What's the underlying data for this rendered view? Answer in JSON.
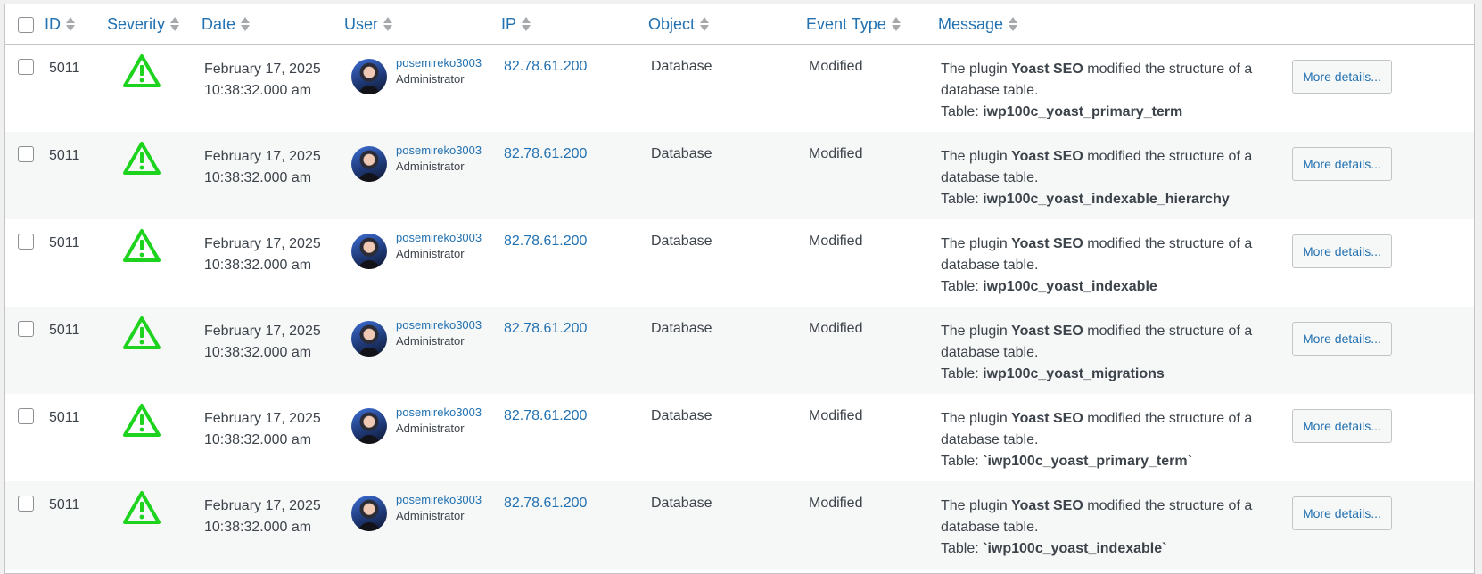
{
  "columns": {
    "id": "ID",
    "severity": "Severity",
    "date": "Date",
    "user": "User",
    "ip": "IP",
    "object": "Object",
    "event_type": "Event Type",
    "message": "Message"
  },
  "severity_icon": "warning-triangle-icon",
  "severity_color": "#1ed31e",
  "rows": [
    {
      "id": "5011",
      "date": "February 17, 2025",
      "time": "10:38:32.000 am",
      "username": "posemireko3003",
      "role": "Administrator",
      "ip": "82.78.61.200",
      "object": "Database",
      "event_type": "Modified",
      "msg_prefix": "The plugin ",
      "msg_plugin": "Yoast SEO",
      "msg_suffix": " modified the structure of a database table.",
      "msg_table_label": "Table: ",
      "msg_table": "iwp100c_yoast_primary_term",
      "more": "More details..."
    },
    {
      "id": "5011",
      "date": "February 17, 2025",
      "time": "10:38:32.000 am",
      "username": "posemireko3003",
      "role": "Administrator",
      "ip": "82.78.61.200",
      "object": "Database",
      "event_type": "Modified",
      "msg_prefix": "The plugin ",
      "msg_plugin": "Yoast SEO",
      "msg_suffix": " modified the structure of a database table.",
      "msg_table_label": "Table: ",
      "msg_table": "iwp100c_yoast_indexable_hierarchy",
      "more": "More details..."
    },
    {
      "id": "5011",
      "date": "February 17, 2025",
      "time": "10:38:32.000 am",
      "username": "posemireko3003",
      "role": "Administrator",
      "ip": "82.78.61.200",
      "object": "Database",
      "event_type": "Modified",
      "msg_prefix": "The plugin ",
      "msg_plugin": "Yoast SEO",
      "msg_suffix": " modified the structure of a database table.",
      "msg_table_label": "Table: ",
      "msg_table": "iwp100c_yoast_indexable",
      "more": "More details..."
    },
    {
      "id": "5011",
      "date": "February 17, 2025",
      "time": "10:38:32.000 am",
      "username": "posemireko3003",
      "role": "Administrator",
      "ip": "82.78.61.200",
      "object": "Database",
      "event_type": "Modified",
      "msg_prefix": "The plugin ",
      "msg_plugin": "Yoast SEO",
      "msg_suffix": " modified the structure of a database table.",
      "msg_table_label": "Table: ",
      "msg_table": "iwp100c_yoast_migrations",
      "more": "More details..."
    },
    {
      "id": "5011",
      "date": "February 17, 2025",
      "time": "10:38:32.000 am",
      "username": "posemireko3003",
      "role": "Administrator",
      "ip": "82.78.61.200",
      "object": "Database",
      "event_type": "Modified",
      "msg_prefix": "The plugin ",
      "msg_plugin": "Yoast SEO",
      "msg_suffix": " modified the structure of a database table.",
      "msg_table_label": "Table: ",
      "msg_table": "`iwp100c_yoast_primary_term`",
      "more": "More details..."
    },
    {
      "id": "5011",
      "date": "February 17, 2025",
      "time": "10:38:32.000 am",
      "username": "posemireko3003",
      "role": "Administrator",
      "ip": "82.78.61.200",
      "object": "Database",
      "event_type": "Modified",
      "msg_prefix": "The plugin ",
      "msg_plugin": "Yoast SEO",
      "msg_suffix": " modified the structure of a database table.",
      "msg_table_label": "Table: ",
      "msg_table": "`iwp100c_yoast_indexable`",
      "more": "More details..."
    }
  ]
}
